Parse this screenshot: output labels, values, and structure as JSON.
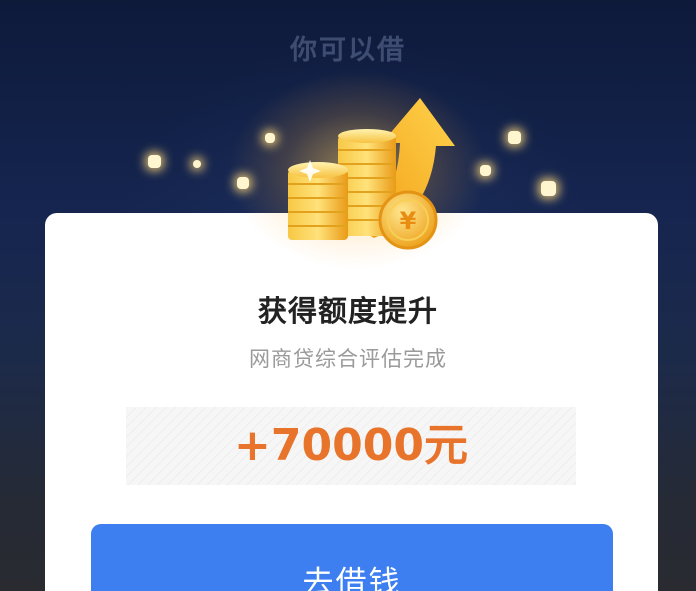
{
  "background": {
    "title": "你可以借"
  },
  "card": {
    "title": "获得额度提升",
    "subtitle": "网商贷综合评估完成",
    "amount": "+70000元",
    "button_label": "去借钱"
  },
  "colors": {
    "accent": "#3d7ff1",
    "amount": "#e8732a",
    "coin": "#f5b928"
  },
  "icons": {
    "hero": "coins-arrow-icon",
    "sparkles": "sparkle-icon"
  }
}
